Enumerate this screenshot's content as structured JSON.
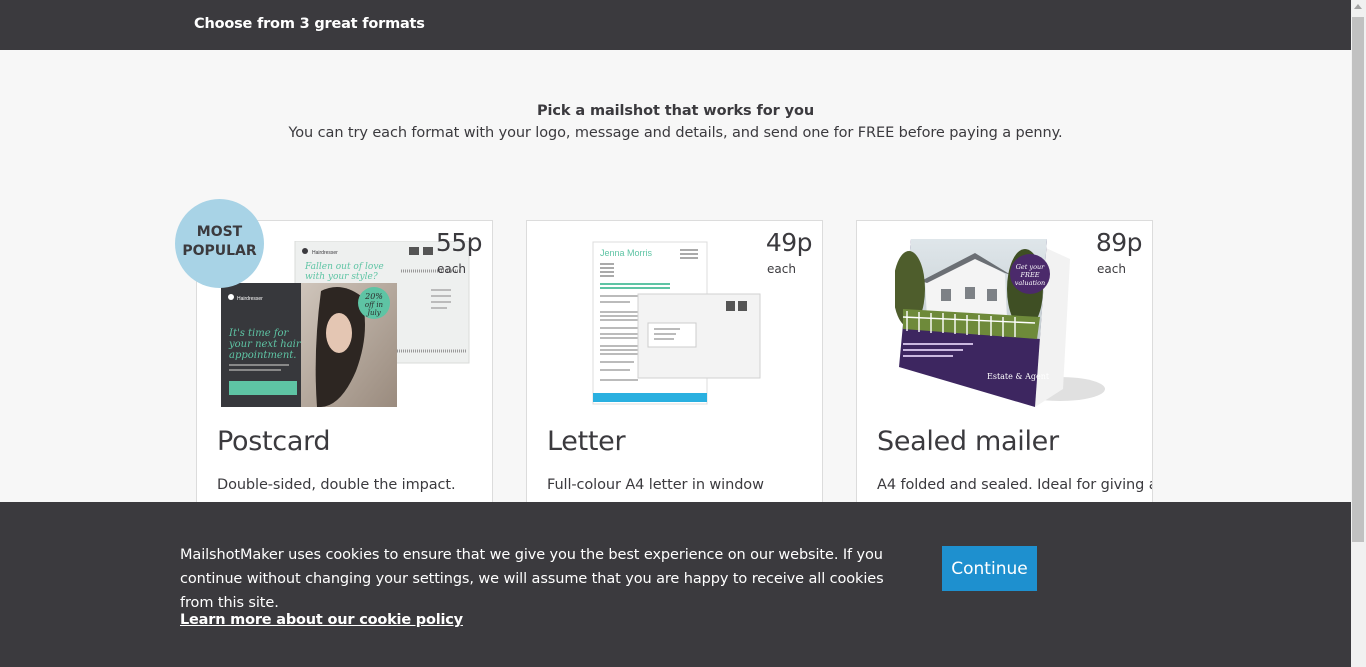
{
  "header": {
    "title": "Choose from 3 great formats"
  },
  "intro": {
    "heading": "Pick a mailshot that works for you",
    "subtext": "You can try each format with your logo, message and details, and send one for FREE before paying a penny."
  },
  "badge": {
    "line1": "MOST",
    "line2": "POPULAR"
  },
  "cards": [
    {
      "price": "55p",
      "each": "each",
      "title": "Postcard",
      "desc": "Double-sided, double the impact.",
      "thumb": {
        "brand": "Hairdresser",
        "headline1": "It's time for",
        "headline2": "your next hair",
        "headline3": "appointment.",
        "promo1": "Fallen out of love",
        "promo2": "with your style?",
        "sticker1": "20%",
        "sticker2": "off in",
        "sticker3": "July"
      }
    },
    {
      "price": "49p",
      "each": "each",
      "title": "Letter",
      "desc": "Full-colour A4 letter in window",
      "thumb": {
        "name": "Jenna Morris"
      }
    },
    {
      "price": "89p",
      "each": "each",
      "title": "Sealed mailer",
      "desc": "A4 folded and sealed. Ideal for giving a",
      "thumb": {
        "stamp1": "Get your",
        "stamp2": "FREE",
        "stamp3": "valuation",
        "agent": "Estate & Agent"
      }
    }
  ],
  "cookie": {
    "message": "MailshotMaker uses cookies to ensure that we give you the best experience on our website. If you continue without changing your settings, we will assume that you are happy to receive all cookies from this site.",
    "link": "Learn more about our cookie policy",
    "button": "Continue"
  },
  "colors": {
    "dark": "#3b3a3e",
    "accent": "#1e90cf",
    "badge": "#a8d3e6",
    "teal": "#5ec4a4",
    "purple": "#4b2a6b"
  }
}
